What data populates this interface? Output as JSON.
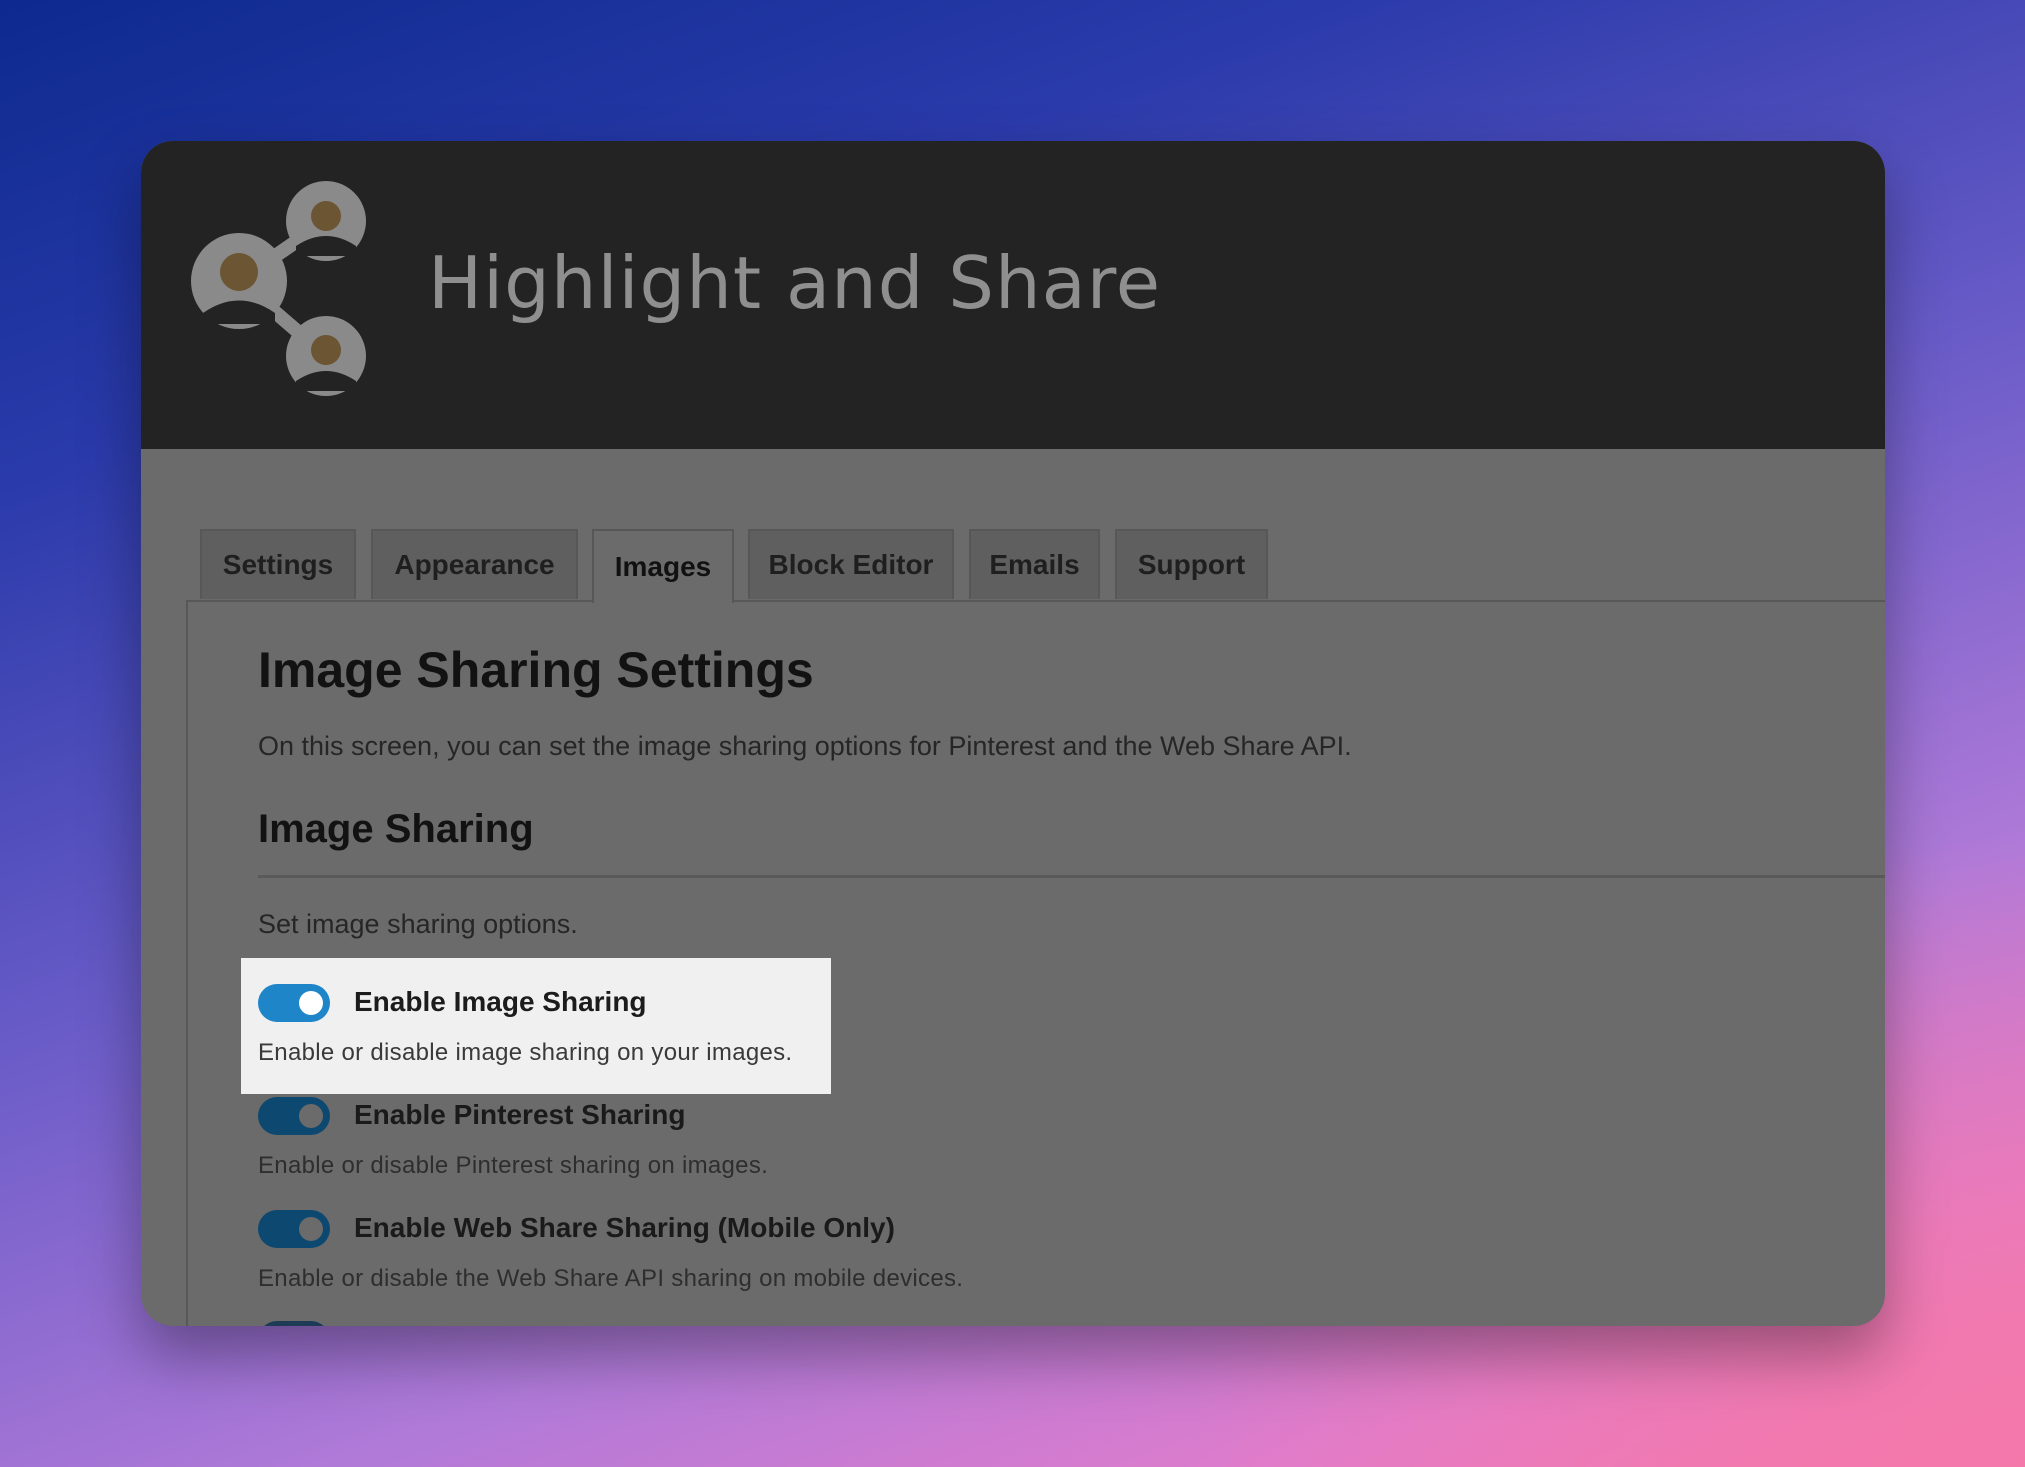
{
  "brand": {
    "title": "Highlight and Share",
    "logo_icon": "share-people-icon"
  },
  "tabs": [
    {
      "label": "Settings",
      "active": false
    },
    {
      "label": "Appearance",
      "active": false
    },
    {
      "label": "Images",
      "active": true
    },
    {
      "label": "Block Editor",
      "active": false
    },
    {
      "label": "Emails",
      "active": false
    },
    {
      "label": "Support",
      "active": false
    }
  ],
  "page": {
    "heading": "Image Sharing Settings",
    "description": "On this screen, you can set the image sharing options for Pinterest and the Web Share API."
  },
  "section": {
    "heading": "Image Sharing",
    "description": "Set image sharing options."
  },
  "options": [
    {
      "label": "Enable Image Sharing",
      "description": "Enable or disable image sharing on your images.",
      "enabled": true,
      "highlighted": true
    },
    {
      "label": "Enable Pinterest Sharing",
      "description": "Enable or disable Pinterest sharing on images.",
      "enabled": true,
      "highlighted": false
    },
    {
      "label": "Enable Web Share Sharing (Mobile Only)",
      "description": "Enable or disable the Web Share API sharing on mobile devices.",
      "enabled": true,
      "highlighted": false
    }
  ],
  "colors": {
    "toggle_on_focused": "#1e85c8",
    "toggle_on_dimmed": "#0d4870",
    "header_bg": "#232323",
    "overlay_bg": "#6b6b6b"
  }
}
